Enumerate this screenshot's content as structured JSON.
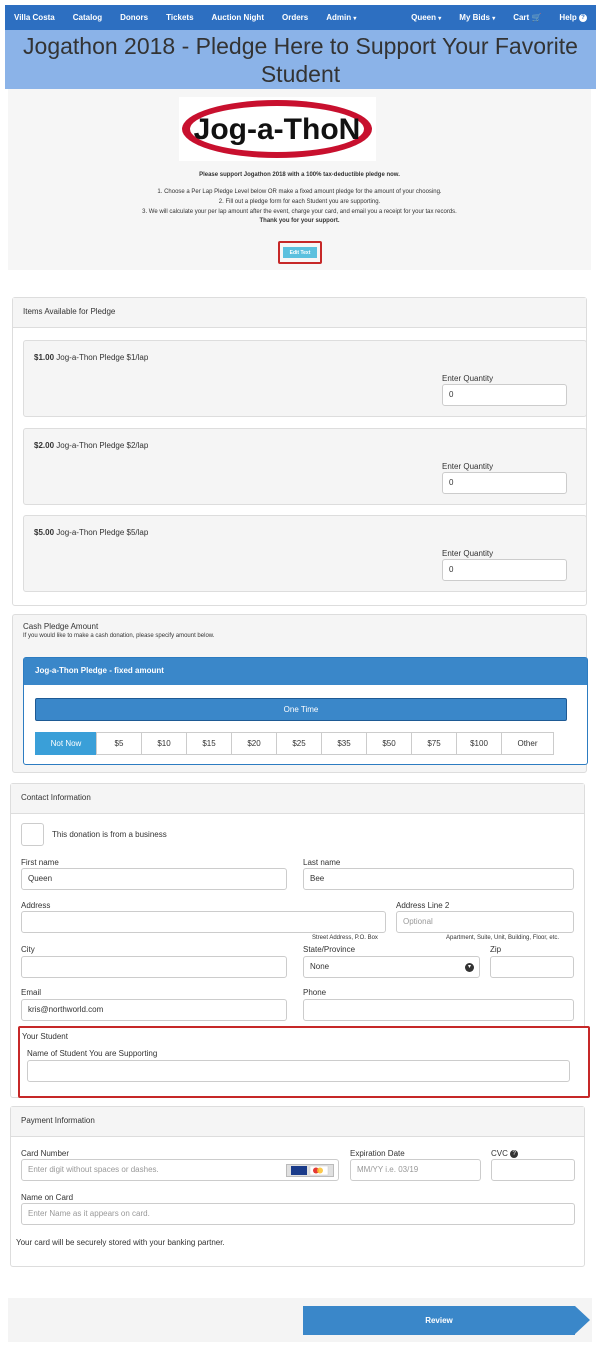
{
  "nav": {
    "brand": "Villa Costa",
    "items": [
      "Catalog",
      "Donors",
      "Tickets",
      "Auction Night",
      "Orders",
      "Admin"
    ],
    "right": [
      "Queen",
      "My Bids",
      "Cart",
      "Help"
    ]
  },
  "header": {
    "title": "Jogathon 2018 - Pledge Here to Support Your Favorite Student"
  },
  "intro": {
    "logo_text": "Jog-a-ThoN",
    "bold_line": "Please support Jogathon 2018 with a 100% tax-deductible pledge now.",
    "step1": "1. Choose a Per Lap Pledge Level below OR make a fixed amount pledge for the amount of your choosing.",
    "step2": "2. Fill out a pledge form for each Student you are supporting.",
    "step3": "3. We will calculate your per lap amount after the event, charge your card, and email you a receipt for your tax records.",
    "thanks": "Thank you for your support.",
    "edit_label": "Edit Text"
  },
  "items_panel": {
    "title": "Items Available for Pledge",
    "items": [
      {
        "price": "$1.00",
        "name": "Jog-a-Thon Pledge $1/lap",
        "qty_label": "Enter Quantity",
        "qty": "0"
      },
      {
        "price": "$2.00",
        "name": "Jog-a-Thon Pledge $2/lap",
        "qty_label": "Enter Quantity",
        "qty": "0"
      },
      {
        "price": "$5.00",
        "name": "Jog-a-Thon Pledge $5/lap",
        "qty_label": "Enter Quantity",
        "qty": "0"
      }
    ]
  },
  "cash_panel": {
    "title": "Cash Pledge Amount",
    "subtitle": "If you would like to make a cash donation, please specify amount below.",
    "jog_title": "Jog-a-Thon Pledge - fixed amount",
    "one_time": "One Time",
    "amounts": [
      "Not Now",
      "$5",
      "$10",
      "$15",
      "$20",
      "$25",
      "$35",
      "$50",
      "$75",
      "$100",
      "Other"
    ]
  },
  "contact": {
    "title": "Contact Information",
    "business_label": "This donation is from a business",
    "first_name_label": "First name",
    "first_name": "Queen",
    "last_name_label": "Last name",
    "last_name": "Bee",
    "address_label": "Address",
    "address": "",
    "address_hint": "Street Address, P.O. Box",
    "address2_label": "Address Line 2",
    "address2_placeholder": "Optional",
    "address2_hint": "Apartment, Suite, Unit, Building, Floor, etc.",
    "city_label": "City",
    "state_label": "State/Province",
    "state_value": "None",
    "zip_label": "Zip",
    "email_label": "Email",
    "email": "kris@northworld.com",
    "phone_label": "Phone",
    "student_section": "Your Student",
    "student_label": "Name of Student You are Supporting"
  },
  "payment": {
    "title": "Payment Information",
    "card_label": "Card Number",
    "card_placeholder": "Enter digit without spaces or dashes.",
    "exp_label": "Expiration Date",
    "exp_placeholder": "MM/YY i.e. 03/19",
    "cvc_label": "CVC",
    "name_label": "Name on Card",
    "name_placeholder": "Enter Name as it appears on card.",
    "note": "Your card will be securely stored with your banking partner."
  },
  "footer": {
    "review_label": "Review"
  }
}
